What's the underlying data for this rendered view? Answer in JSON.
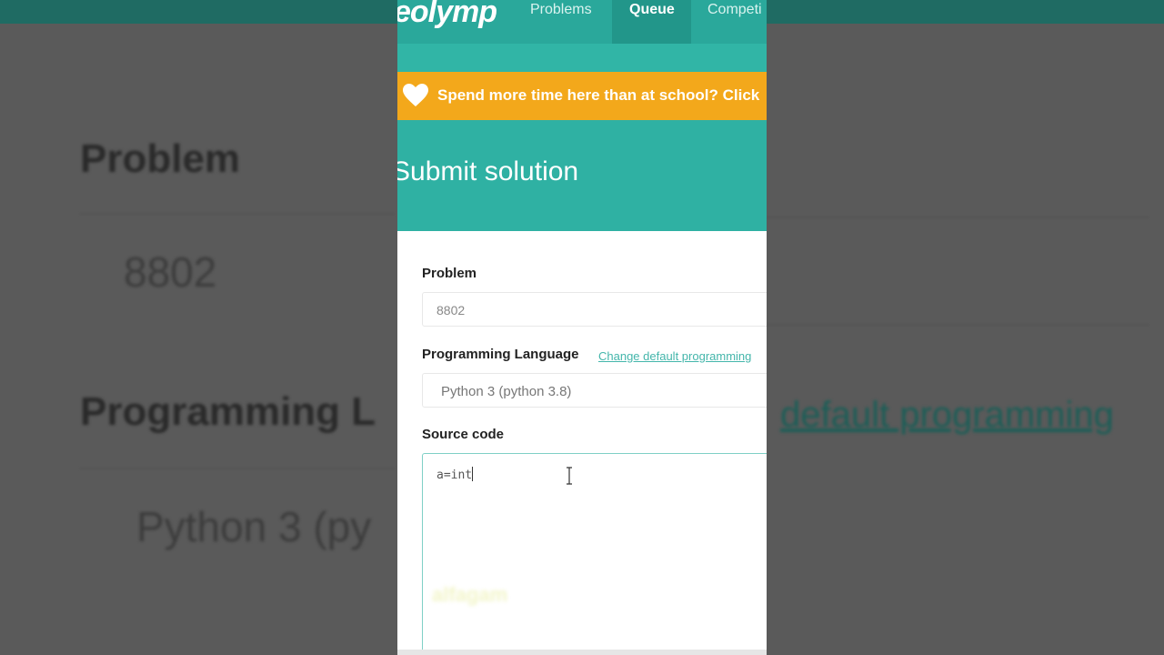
{
  "background": {
    "heading_problem": "Problem",
    "problem_value": "8802",
    "heading_language": "Programming L",
    "language_value": "Python 3 (py",
    "link_fragment": "default programming"
  },
  "nav": {
    "logo": "eolymp",
    "items": [
      {
        "label": "Problems",
        "active": false
      },
      {
        "label": "Queue",
        "active": true
      },
      {
        "label": "Competi",
        "active": false
      }
    ]
  },
  "banner": {
    "icon": "heart-icon",
    "text": "Spend more time here than at school? Click"
  },
  "hero": {
    "title": "Submit solution"
  },
  "form": {
    "problem_label": "Problem",
    "problem_value": "8802",
    "language_label": "Programming Language",
    "language_link": "Change default programming",
    "language_value": "Python 3 (python 3.8)",
    "source_label": "Source code",
    "source_value": "a=int",
    "watermark": "alfagam"
  },
  "colors": {
    "teal": "#2fb1a3",
    "banner": "#f3a81b"
  }
}
